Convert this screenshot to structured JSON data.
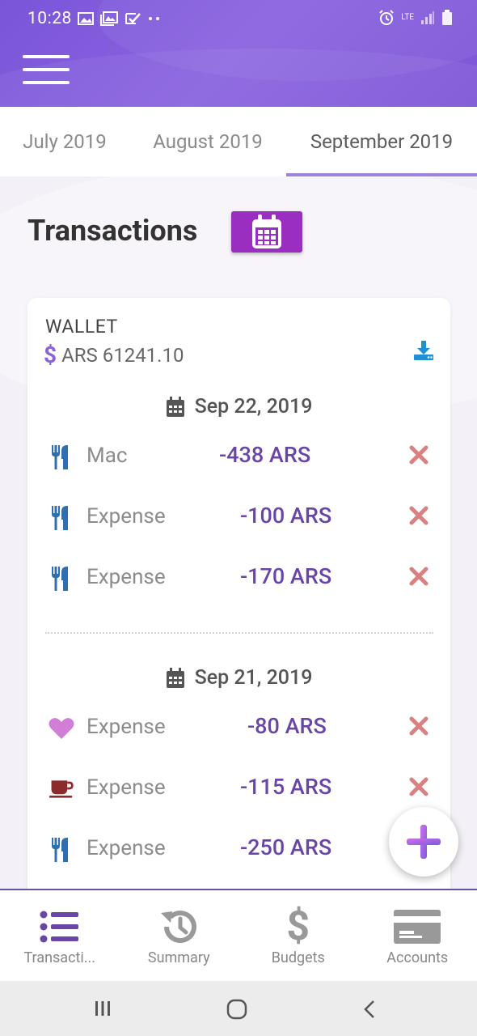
{
  "status_bar": {
    "time": "10:28",
    "network": "LTE"
  },
  "tabs": [
    {
      "label": "July 2019",
      "active": false
    },
    {
      "label": "August 2019",
      "active": false
    },
    {
      "label": "September 2019",
      "active": true
    }
  ],
  "page": {
    "title": "Transactions"
  },
  "wallet": {
    "label": "WALLET",
    "currency_symbol": "$",
    "balance": "ARS 61241.10"
  },
  "groups": [
    {
      "date": "Sep 22, 2019",
      "transactions": [
        {
          "icon": "utensils-icon",
          "name": "Mac",
          "amount": "-438 ARS"
        },
        {
          "icon": "utensils-icon",
          "name": "Expense",
          "amount": "-100 ARS"
        },
        {
          "icon": "utensils-icon",
          "name": "Expense",
          "amount": "-170 ARS"
        }
      ]
    },
    {
      "date": "Sep 21, 2019",
      "transactions": [
        {
          "icon": "heart-icon",
          "name": "Expense",
          "amount": "-80 ARS"
        },
        {
          "icon": "coffee-icon",
          "name": "Expense",
          "amount": "-115 ARS"
        },
        {
          "icon": "utensils-icon",
          "name": "Expense",
          "amount": "-250 ARS"
        }
      ]
    }
  ],
  "bottom_nav": [
    {
      "label": "Transacti...",
      "icon": "list-icon",
      "active": true
    },
    {
      "label": "Summary",
      "icon": "history-icon",
      "active": false
    },
    {
      "label": "Budgets",
      "icon": "dollar-icon",
      "active": false
    },
    {
      "label": "Accounts",
      "icon": "credit-card-icon",
      "active": false
    }
  ],
  "colors": {
    "header": "#7a55d8",
    "accent": "#9a2ec0",
    "amount": "#6a45a8",
    "delete": "#d98080",
    "utensils": "#2f6fb0"
  }
}
